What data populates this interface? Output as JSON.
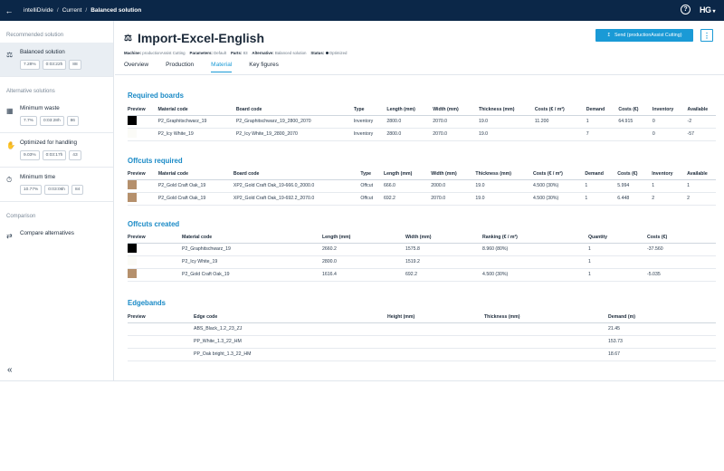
{
  "topbar": {
    "app": "intelliDivide",
    "crumb1": "Current",
    "crumb2": "Balanced solution",
    "logo": "HG"
  },
  "sidebar": {
    "sec_recommended": "Recommended solution",
    "sec_alternative": "Alternative solutions",
    "sec_comparison": "Comparison",
    "items": [
      {
        "label": "Balanced solution",
        "chips": [
          "7.28%",
          "0:03:22h",
          "88"
        ]
      },
      {
        "label": "Minimum waste",
        "chips": [
          "7.7%",
          "0:03:28h",
          "86"
        ]
      },
      {
        "label": "Optimized for handling",
        "chips": [
          "9.03%",
          "0:03:17h",
          "43"
        ]
      },
      {
        "label": "Minimum time",
        "chips": [
          "10.77%",
          "0:03:06h",
          "84"
        ]
      }
    ],
    "compare": "Compare alternatives"
  },
  "header": {
    "title": "Import-Excel-English",
    "machine_label": "Machine:",
    "machine": "productionAssist Cutting",
    "params_label": "Parameters:",
    "params": "Default",
    "parts_label": "Parts:",
    "parts": "83",
    "alt_label": "Alternative:",
    "alt": "Balanced solution",
    "status_label": "Status:",
    "status": "Optimized",
    "send": "Send (productionAssist Cutting)"
  },
  "tabs": [
    "Overview",
    "Production",
    "Material",
    "Key figures"
  ],
  "required_boards": {
    "title": "Required boards",
    "headers": [
      "Preview",
      "Material code",
      "Board code",
      "Type",
      "Length (mm)",
      "Width (mm)",
      "Thickness (mm)",
      "Costs (€ / m²)",
      "Demand",
      "Costs (€)",
      "Inventory",
      "Available"
    ],
    "rows": [
      {
        "color": "#000000",
        "cells": [
          "P2_Graphitschwarz_19",
          "P2_Graphitschwarz_19_2800_2070",
          "Inventory",
          "2800.0",
          "2070.0",
          "19.0",
          "11.200",
          "1",
          "64.915",
          "0",
          "-2"
        ]
      },
      {
        "color": "#fbfbf7",
        "cells": [
          "P2_Icy White_19",
          "P2_Icy White_19_2800_2070",
          "Inventory",
          "2800.0",
          "2070.0",
          "19.0",
          "",
          "7",
          "",
          "0",
          "-57"
        ]
      }
    ]
  },
  "offcuts_required": {
    "title": "Offcuts required",
    "headers": [
      "Preview",
      "Material code",
      "Board code",
      "Type",
      "Length (mm)",
      "Width (mm)",
      "Thickness (mm)",
      "Costs (€ / m²)",
      "Demand",
      "Costs (€)",
      "Inventory",
      "Available"
    ],
    "rows": [
      {
        "color": "#b5906c",
        "cells": [
          "P2_Gold Craft Oak_19",
          "XP2_Gold Craft Oak_19-666.0_2000.0",
          "Offcut",
          "666.0",
          "2000.0",
          "19.0",
          "4.500 (30%)",
          "1",
          "5.994",
          "1",
          "1"
        ]
      },
      {
        "color": "#b5906c",
        "cells": [
          "P2_Gold Craft Oak_19",
          "XP2_Gold Craft Oak_19-692.2_2070.0",
          "Offcut",
          "692.2",
          "2070.0",
          "19.0",
          "4.500 (30%)",
          "1",
          "6.448",
          "2",
          "2"
        ]
      }
    ]
  },
  "offcuts_created": {
    "title": "Offcuts created",
    "headers": [
      "Preview",
      "Material code",
      "Length (mm)",
      "Width (mm)",
      "Ranking (€ / m²)",
      "Quantity",
      "Costs (€)"
    ],
    "rows": [
      {
        "color": "#000000",
        "cells": [
          "P2_Graphitschwarz_19",
          "2660.2",
          "1575.8",
          "8.960 (80%)",
          "1",
          "-37.560"
        ]
      },
      {
        "color": "#fbfbf7",
        "cells": [
          "P2_Icy White_19",
          "2800.0",
          "1519.2",
          "",
          "1",
          ""
        ]
      },
      {
        "color": "#b5906c",
        "cells": [
          "P2_Gold Craft Oak_19",
          "1616.4",
          "692.2",
          "4.500 (30%)",
          "1",
          "-5.035"
        ]
      }
    ]
  },
  "edgebands": {
    "title": "Edgebands",
    "headers": [
      "Preview",
      "Edge code",
      "Height (mm)",
      "Thickness (mm)",
      "Demand (m)"
    ],
    "rows": [
      {
        "cells": [
          "ABS_Black_1.2_23_ZJ",
          "",
          "",
          "21.45"
        ]
      },
      {
        "cells": [
          "PP_White_1.3_22_HM",
          "",
          "",
          "153.73"
        ]
      },
      {
        "cells": [
          "PP_Oak bright_1.3_22_HM",
          "",
          "",
          "18.67"
        ]
      }
    ]
  }
}
